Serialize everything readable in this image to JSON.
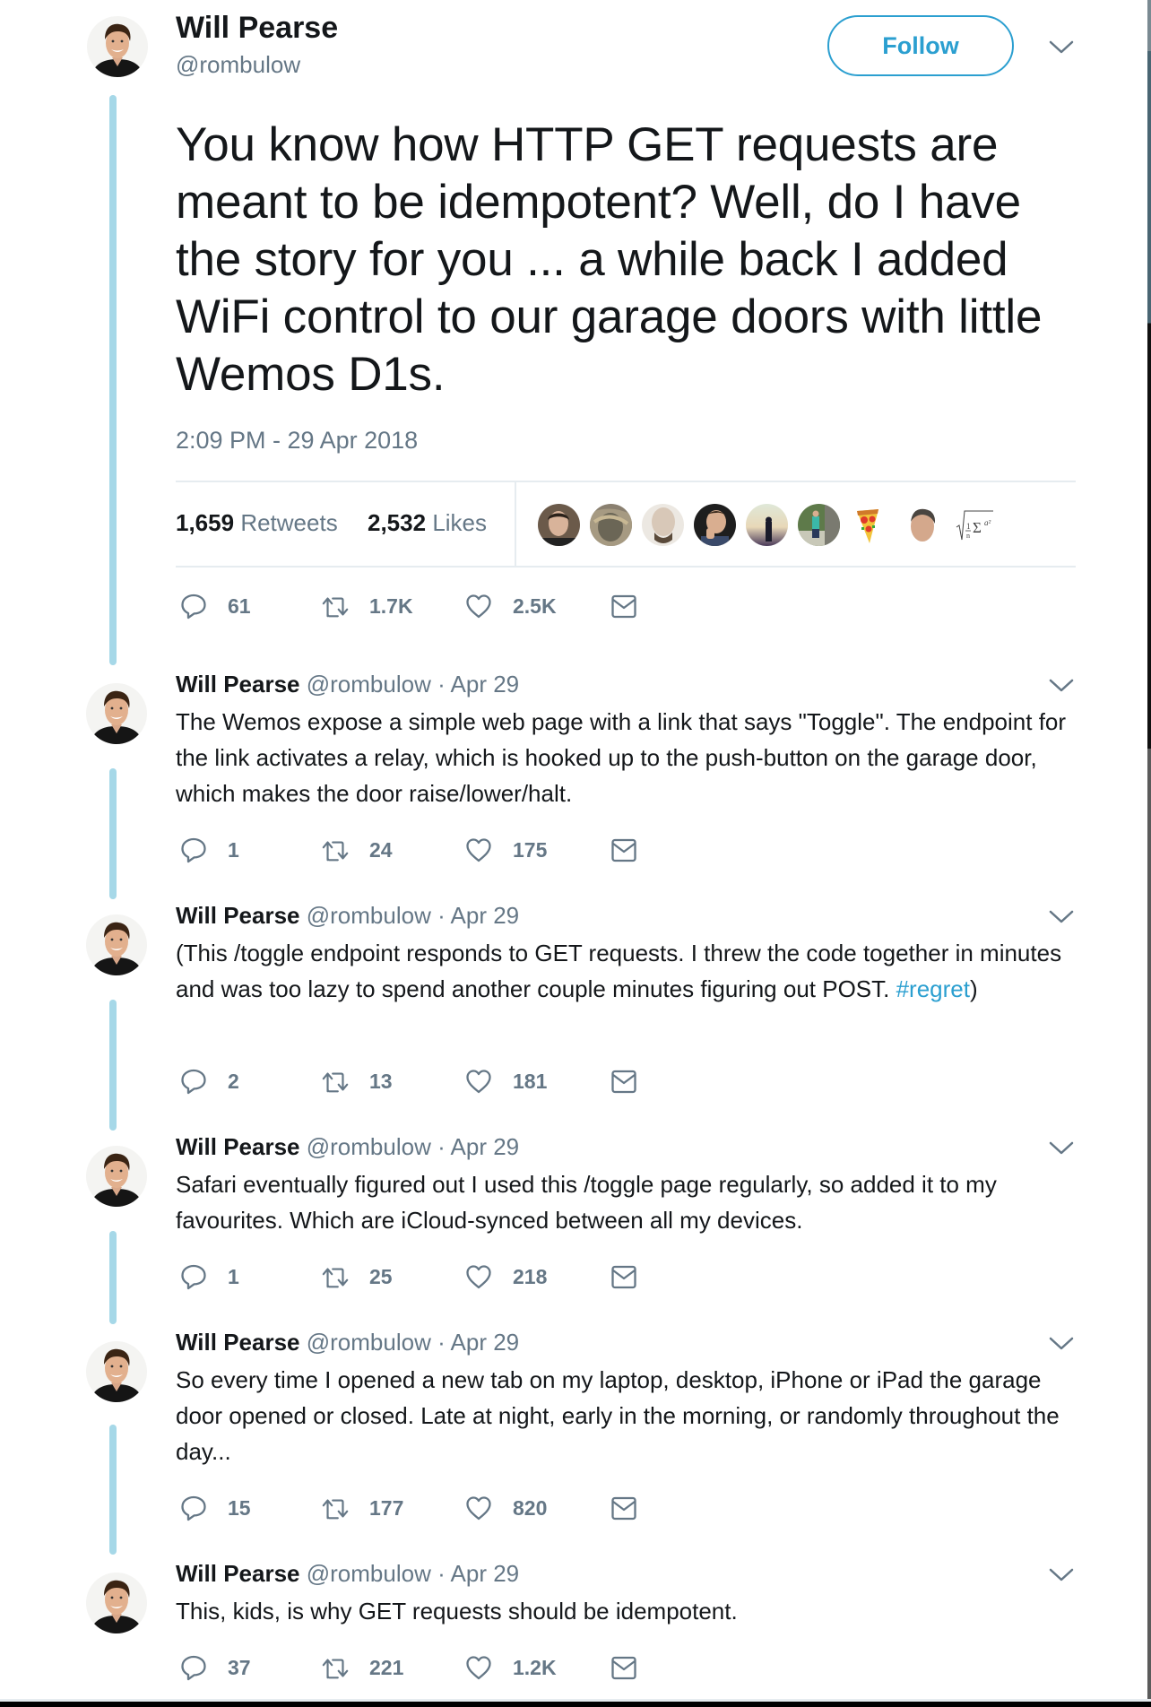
{
  "author": {
    "name": "Will Pearse",
    "handle": "@rombulow"
  },
  "main_tweet": {
    "follow_label": "Follow",
    "text": "You know how HTTP GET requests are meant to be idempotent? Well, do I have the story for you ... a while back I added WiFi control to our garage doors with little Wemos D1s.",
    "timestamp": "2:09 PM - 29 Apr 2018",
    "retweet_count": "1,659",
    "retweet_label": "Retweets",
    "like_count": "2,532",
    "like_label": "Likes",
    "likers": [
      "liker-avatar-1",
      "liker-avatar-2",
      "liker-avatar-3",
      "liker-avatar-4",
      "liker-avatar-5",
      "liker-avatar-6",
      "liker-avatar-pizza",
      "liker-avatar-8",
      "liker-avatar-math-formula"
    ],
    "actions": {
      "replies": "61",
      "retweets": "1.7K",
      "likes": "2.5K"
    }
  },
  "replies": [
    {
      "date": "· Apr 29",
      "text": "The Wemos expose a simple web page with a link that says \"Toggle\".  The endpoint for the link activates a relay, which is hooked up to the push-button on the garage door, which makes the door raise/lower/halt.",
      "actions": {
        "replies": "1",
        "retweets": "24",
        "likes": "175"
      }
    },
    {
      "date": "· Apr 29",
      "text": "(This /toggle endpoint responds to GET requests. I threw the code together in minutes and was too lazy to spend another couple minutes figuring out POST. ",
      "hashtag": "#regret",
      "text_after": ")",
      "actions": {
        "replies": "2",
        "retweets": "13",
        "likes": "181"
      }
    },
    {
      "date": "· Apr 29",
      "text": "Safari eventually figured out I used this /toggle page regularly, so added it to my favourites. Which are iCloud-synced between all my devices.",
      "actions": {
        "replies": "1",
        "retweets": "25",
        "likes": "218"
      }
    },
    {
      "date": "· Apr 29",
      "text": "So every time I opened a new tab on my laptop, desktop, iPhone or iPad the garage door opened or closed. Late at night, early in the morning, or randomly throughout the day...",
      "actions": {
        "replies": "15",
        "retweets": "177",
        "likes": "820"
      }
    },
    {
      "date": "· Apr 29",
      "text": "This, kids, is why GET requests should be idempotent.",
      "actions": {
        "replies": "37",
        "retweets": "221",
        "likes": "1.2K"
      }
    }
  ],
  "colors": {
    "accent": "#2b9fd0",
    "secondary_text": "#657786",
    "thread_line": "#a6d8e8",
    "divider": "#e6ecf0"
  }
}
